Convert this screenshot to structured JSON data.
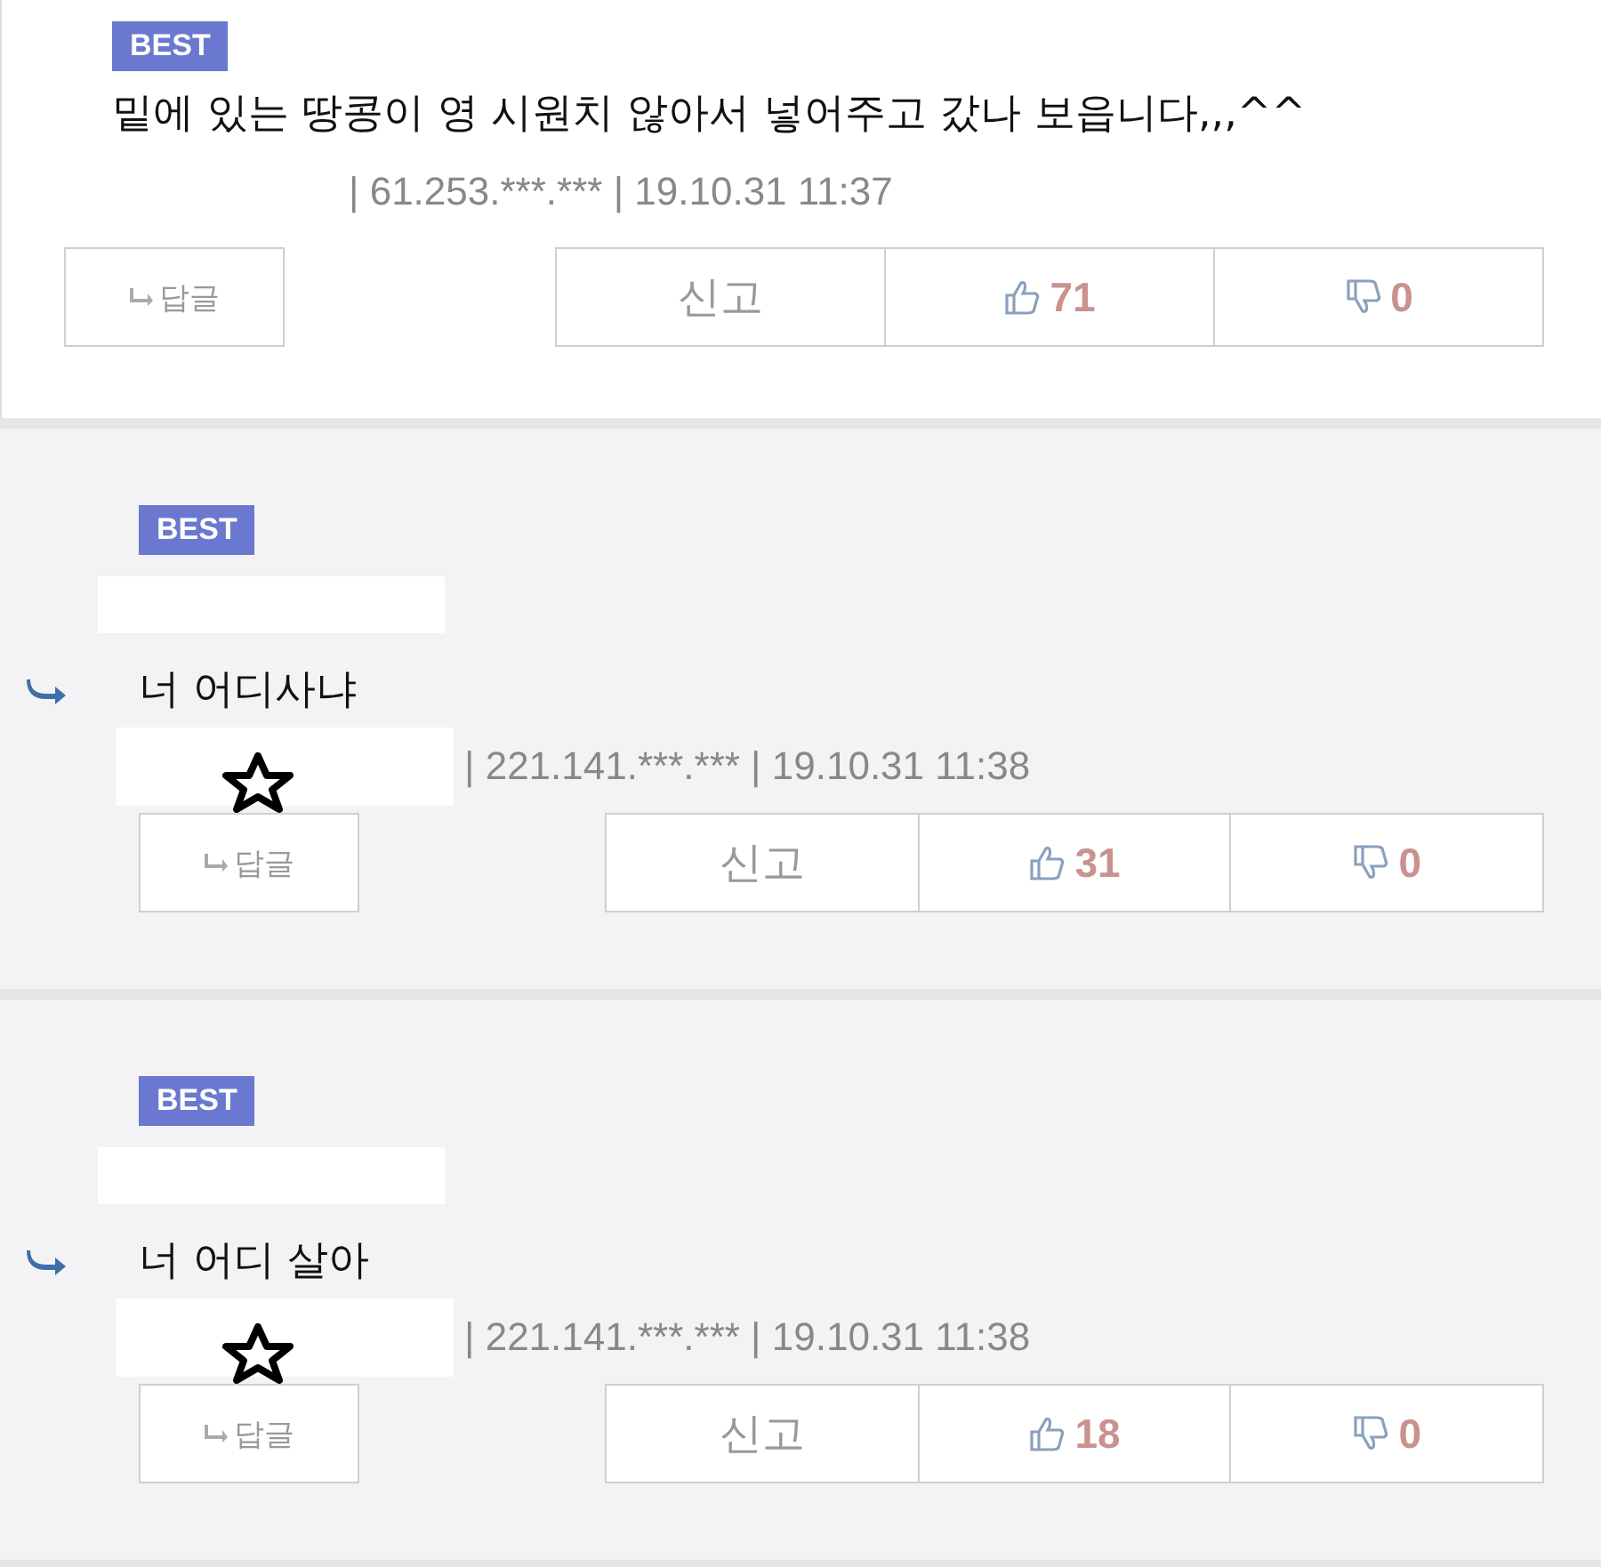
{
  "comments": [
    {
      "kind": "top",
      "badge": "BEST",
      "text": "밑에 있는 땅콩이 영 시원치 않아서 넣어주고 갔나 보읍니다,,,^^",
      "meta": "| 61.253.***.*** | 19.10.31 11:37",
      "reply_button": "답글",
      "report_button": "신고",
      "likes": "71",
      "dislikes": "0"
    },
    {
      "kind": "reply",
      "badge": "BEST",
      "text": "너 어디사냐",
      "meta": "| 221.141.***.*** | 19.10.31 11:38",
      "reply_button": "답글",
      "report_button": "신고",
      "likes": "31",
      "dislikes": "0"
    },
    {
      "kind": "reply",
      "badge": "BEST",
      "text": "너 어디 살아",
      "meta": "| 221.141.***.*** | 19.10.31 11:38",
      "reply_button": "답글",
      "report_button": "신고",
      "likes": "18",
      "dislikes": "0"
    }
  ]
}
